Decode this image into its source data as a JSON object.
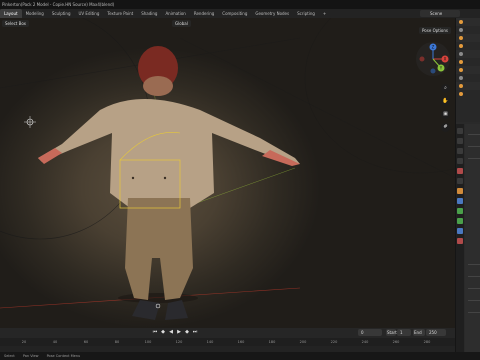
{
  "window": {
    "title": "Pinkerton(Pack 2 Model - Copie.HN Source) Max4(blend)"
  },
  "menubar": {
    "tabs": [
      "Layout",
      "Modeling",
      "Sculpting",
      "UV Editing",
      "Texture Paint",
      "Shading",
      "Animation",
      "Rendering",
      "Compositing",
      "Geometry Nodes",
      "Scripting",
      "+"
    ],
    "active_tab": "Layout",
    "scene": "Scene"
  },
  "viewport": {
    "header": {
      "mode": "Select Box",
      "orientation": "Global"
    },
    "pose_options": "Pose Options",
    "gizmo": {
      "x": "X",
      "y": "Y",
      "z": "Z"
    },
    "nav_icons": [
      "zoom-icon",
      "hand-icon",
      "camera-icon",
      "grid-icon"
    ]
  },
  "timeline": {
    "current_frame": "0",
    "start_label": "Start",
    "start": "1",
    "end_label": "End",
    "end": "250",
    "ruler": [
      "20",
      "40",
      "60",
      "80",
      "100",
      "120",
      "140",
      "160",
      "180",
      "200",
      "220",
      "240",
      "260",
      "280"
    ]
  },
  "statusbar": {
    "items": [
      "Select",
      "Pan View",
      "Pose Context Menu"
    ]
  },
  "colors": {
    "accent": "#e39a3c",
    "selection": "#e6c83a",
    "axis_x": "#d8433c",
    "axis_y": "#8ac43a",
    "axis_z": "#3c78d8"
  }
}
